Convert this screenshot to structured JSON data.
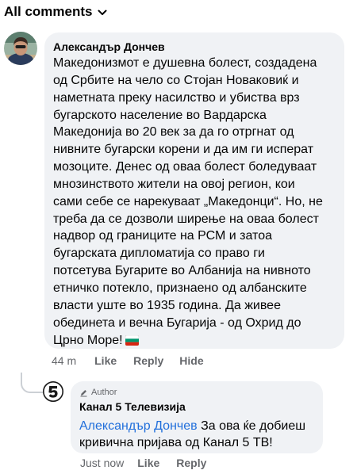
{
  "header": {
    "filter_label": "All comments",
    "filter_icon": "chevron-down-icon"
  },
  "comment": {
    "author": "Александър Дончев",
    "avatar_icon": "profile-photo",
    "text_lines": [
      "Македонизмот е душевна болест, создадена",
      "од Србите на чело со Стојан Новаковиќ и",
      "наметната преку насилство и убиства врз",
      "бугарското население во Вардарска",
      "Македонија во 20 век за да го отргнат од",
      "нивните бугарски корени и да им ги исперат",
      "мозоците. Денес од оваа болест боледуваат",
      "мнозинството жители на овој регион, кои",
      "сами себе се нарекуваат „Македонци“. Но, не",
      "треба да се дозволи ширење на оваа болест",
      "надвор од границите на РСМ и затоа",
      "бугарската дипломатија со право ги",
      "потсетува Бугарите во Албанија на нивното",
      "етничко потекло, признаено од албанските",
      "власти уште во 1935 година. Да живее",
      "обединета и вечна Бугарија - од Охрид до",
      "Црно Море!"
    ],
    "flag_icon": "bulgarian-flag-emoji",
    "time": "44 m",
    "like_label": "Like",
    "reply_label": "Reply",
    "hide_label": "Hide"
  },
  "reply": {
    "badge_label": "Author",
    "badge_icon": "pen-icon",
    "author": "Канал 5 Телевизија",
    "avatar_icon": "kanal5-logo",
    "mention": "Александър Дончев",
    "text_line1": " За ова ќе добиеш",
    "text_line2": "кривична пријава од Канал 5 ТВ!",
    "time": "Just now",
    "like_label": "Like",
    "reply_label": "Reply"
  },
  "colors": {
    "bubble_bg": "#f0f2f5",
    "meta_text": "#65676b",
    "mention_link": "#216fdb",
    "thread_line": "#ccd0d5"
  }
}
